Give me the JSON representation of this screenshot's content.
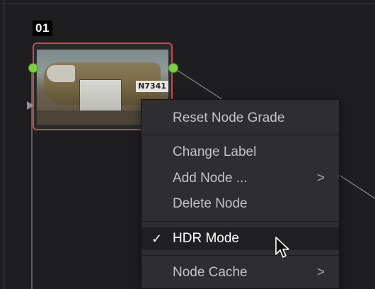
{
  "node": {
    "label": "01",
    "thumbnail_text": "N7341"
  },
  "context_menu": {
    "items": [
      {
        "label": "Reset Node Grade",
        "submenu": false,
        "checked": false
      },
      {
        "label": "Change Label",
        "submenu": false,
        "checked": false
      },
      {
        "label": "Add Node ...",
        "submenu": true,
        "checked": false
      },
      {
        "label": "Delete Node",
        "submenu": false,
        "checked": false
      },
      {
        "label": "HDR Mode",
        "submenu": false,
        "checked": true
      },
      {
        "label": "Node Cache",
        "submenu": true,
        "checked": false
      }
    ],
    "check_glyph": "✓",
    "submenu_glyph": ">"
  },
  "colors": {
    "node_border_selected": "#d9433d",
    "port_green": "#7bd23b",
    "menu_bg": "#2e2e31",
    "menu_highlight": "#202023"
  }
}
